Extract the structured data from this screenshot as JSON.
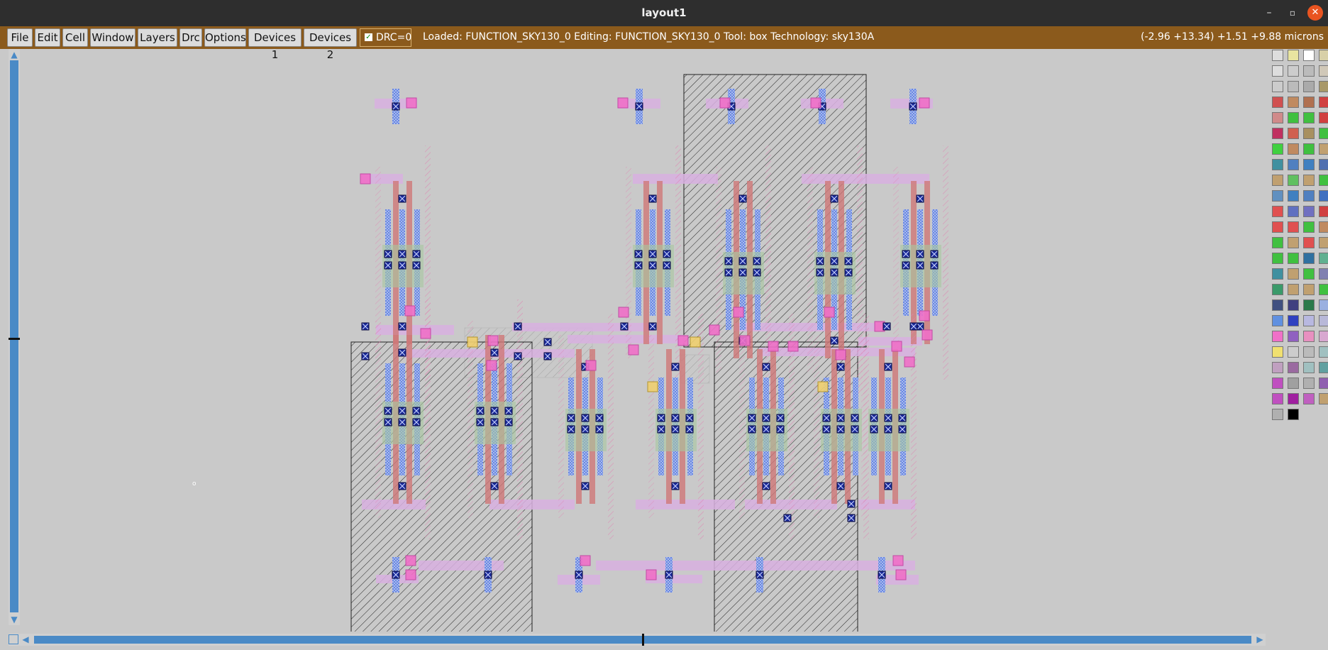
{
  "window": {
    "title": "layout1",
    "minimize_glyph": "–",
    "maximize_glyph": "▫",
    "close_glyph": "✕"
  },
  "menubar": {
    "items": [
      "File",
      "Edit",
      "Cell",
      "Window",
      "Layers",
      "Drc",
      "Options",
      "Devices 1",
      "Devices 2"
    ],
    "drc_label": "DRC=0",
    "drc_checked": true,
    "status": "Loaded: FUNCTION_SKY130_0 Editing: FUNCTION_SKY130_0 Tool: box  Technology: sky130A",
    "coordinates": "(-2.96 +13.34) +1.51 +9.88 microns",
    "bar_color": "#8b5a1c"
  },
  "canvas": {
    "cursor_marker": "o"
  },
  "colors": {
    "background": "#c9c9c9",
    "scroll": "#4a8ac6",
    "li_blue": "#7a9ae0",
    "contact": "#1a2a9a",
    "poly": "#d07878",
    "pmet": "#d8a8e0",
    "pink": "#f070c8",
    "nwell_hatch": "#222222",
    "diff_green": "#60c060"
  },
  "palette": {
    "icons": [
      "grid-icon",
      "layer-swatch-icon"
    ]
  }
}
